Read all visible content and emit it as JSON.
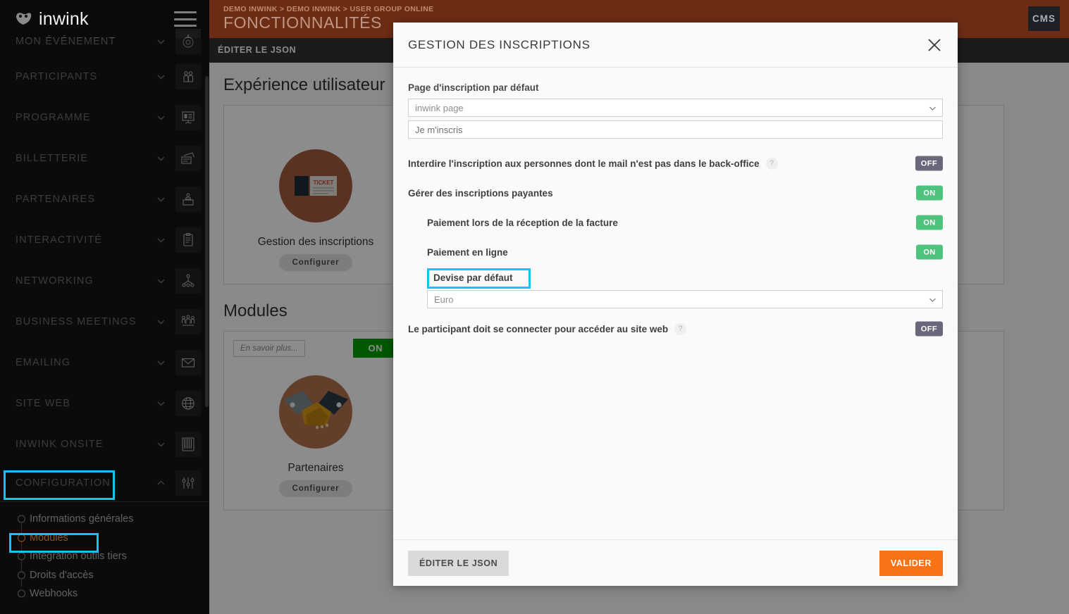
{
  "app": {
    "logo_text": "inwink",
    "hamburger": "hamburger-menu"
  },
  "topbar": {
    "breadcrumb": "DEMO INWINK > DEMO INWINK > USER GROUP ONLINE",
    "title": "FONCTIONNALITÉS",
    "cms_label": "CMS",
    "subbar_label": "ÉDITER LE JSON"
  },
  "sidebar": {
    "items": [
      {
        "label": "MON ÉVÉNEMENT",
        "icon": "target-icon",
        "expanded": false
      },
      {
        "label": "PARTICIPANTS",
        "icon": "people-icon",
        "expanded": false
      },
      {
        "label": "PROGRAMME",
        "icon": "presentation-icon",
        "expanded": false
      },
      {
        "label": "BILLETTERIE",
        "icon": "tickets-icon",
        "expanded": false
      },
      {
        "label": "PARTENAIRES",
        "icon": "booth-icon",
        "expanded": false
      },
      {
        "label": "INTERACTIVITÉ",
        "icon": "clipboard-icon",
        "expanded": false
      },
      {
        "label": "NETWORKING",
        "icon": "network-icon",
        "expanded": false
      },
      {
        "label": "BUSINESS MEETINGS",
        "icon": "meeting-icon",
        "expanded": false
      },
      {
        "label": "EMAILING",
        "icon": "envelope-icon",
        "expanded": false
      },
      {
        "label": "SITE WEB",
        "icon": "globe-icon",
        "expanded": false
      },
      {
        "label": "INWINK ONSITE",
        "icon": "barcode-icon",
        "expanded": false
      },
      {
        "label": "CONFIGURATION",
        "icon": "sliders-icon",
        "expanded": true
      }
    ],
    "sub_items": [
      {
        "label": "Informations générales",
        "active": false
      },
      {
        "label": "Modules",
        "active": true
      },
      {
        "label": "Intégration outils tiers",
        "active": false
      },
      {
        "label": "Droits d'accès",
        "active": false
      },
      {
        "label": "Webhooks",
        "active": false
      }
    ]
  },
  "main": {
    "sections": [
      {
        "title": "Expérience utilisateur",
        "cards": [
          {
            "label": "Gestion des inscriptions",
            "icon": "ticket-icon",
            "configure_label": "Configurer",
            "has_top_row": false
          }
        ]
      },
      {
        "title": "Modules",
        "cards": [
          {
            "label": "Partenaires",
            "icon": "handshake-icon",
            "configure_label": "Configurer",
            "has_top_row": true,
            "learn_more_label": "En savoir plus...",
            "toggle_label": "ON"
          }
        ]
      }
    ]
  },
  "modal": {
    "title": "GESTION DES INSCRIPTIONS",
    "close_label": "close-icon",
    "default_page": {
      "label": "Page d'inscription par défaut",
      "select_value": "inwink page",
      "text_value": "Je m'inscris"
    },
    "toggles": [
      {
        "label": "Interdire l'inscription aux personnes dont le mail n'est pas dans le back-office",
        "state": "OFF",
        "has_help": true,
        "sub": false
      },
      {
        "label": "Gérer des inscriptions payantes",
        "state": "ON",
        "has_help": false,
        "sub": false
      },
      {
        "label": "Paiement lors de la réception de la facture",
        "state": "ON",
        "has_help": false,
        "sub": true
      },
      {
        "label": "Paiement en ligne",
        "state": "ON",
        "has_help": false,
        "sub": true
      }
    ],
    "currency": {
      "label": "Devise par défaut",
      "value": "Euro"
    },
    "last_toggle": {
      "label": "Le participant doit se connecter pour accéder au site web",
      "state": "OFF",
      "has_help": true
    },
    "footer": {
      "json_label": "ÉDITER LE JSON",
      "validate_label": "VALIDER"
    }
  },
  "colors": {
    "brand_orange": "#f97316",
    "topbar_brown": "#6d2d14",
    "toggle_on": "#4dc37e",
    "toggle_off": "#68687a",
    "highlight_cyan": "#17c3f2",
    "card_on_green": "#00a000",
    "sidebar_bg": "#111111",
    "active_sub_orange": "#d07b2a"
  }
}
